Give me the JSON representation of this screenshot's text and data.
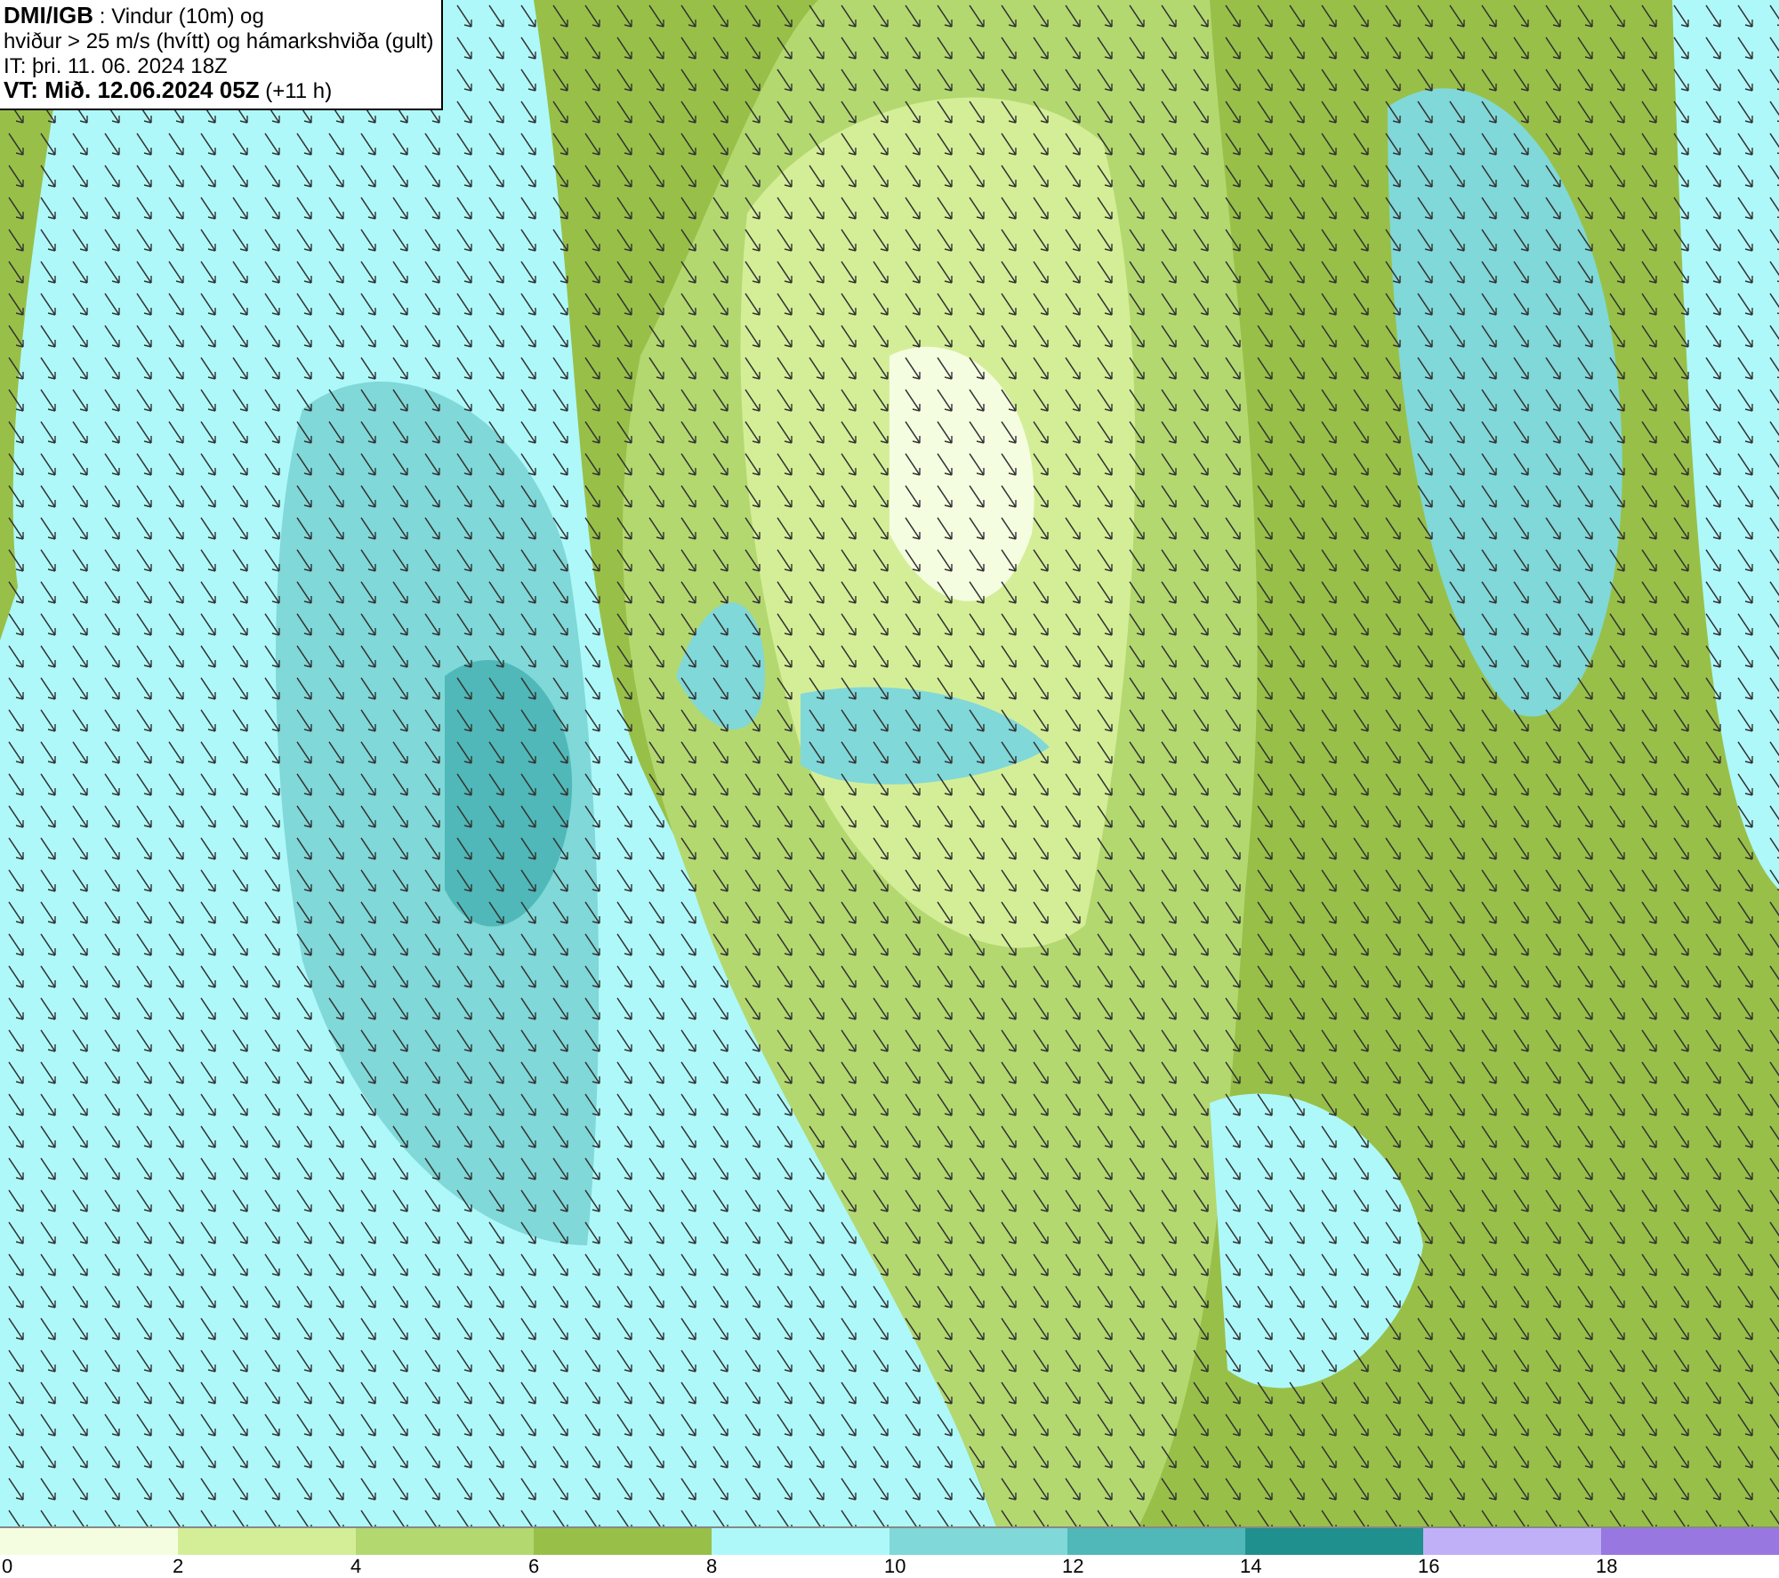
{
  "info_box": {
    "lines": [
      "**DMI/IGB** : Vindur (10m) og",
      "hviður > 25 m/s (hvítt) og hámarkshviða (gult)",
      "IT: þri. 11. 06. 2024 18Z",
      "**VT: Mið. 12.06.2024 05Z** (+11 h)"
    ]
  },
  "legend": {
    "bins": [
      {
        "color": "#f5fde0",
        "label": "0"
      },
      {
        "color": "#d4ee98",
        "label": "2"
      },
      {
        "color": "#b4d870",
        "label": "4"
      },
      {
        "color": "#98c048",
        "label": "6"
      },
      {
        "color": "#aef8fa",
        "label": "8"
      },
      {
        "color": "#80d8d8",
        "label": "10"
      },
      {
        "color": "#50b8b8",
        "label": "12"
      },
      {
        "color": "#20908e",
        "label": "14"
      },
      {
        "color": "#c0b0f8",
        "label": "16"
      },
      {
        "color": "#9878e0",
        "label": "18"
      }
    ]
  }
}
